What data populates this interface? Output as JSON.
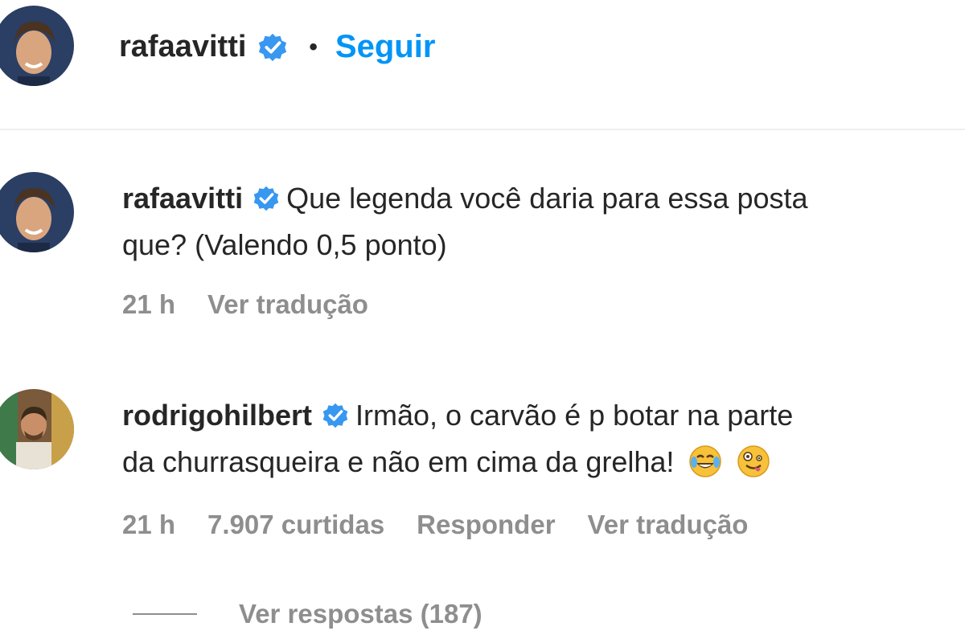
{
  "post_header": {
    "username": "rafaavitti",
    "separator": "•",
    "follow_label": "Seguir"
  },
  "comments": [
    {
      "username": "rafaavitti",
      "text_line1": "Que legenda você daria para essa posta",
      "text_line2": "que? (Valendo 0,5 ponto)",
      "time": "21 h",
      "translate_label": "Ver tradução"
    },
    {
      "username": "rodrigohilbert",
      "text_line1": "Irmão, o carvão é p botar na parte",
      "text_line2": "da churrasqueira e não em cima da grelha!",
      "emojis": [
        "tears-of-joy-emoji",
        "zany-face-emoji"
      ],
      "time": "21 h",
      "likes": "7.907 curtidas",
      "reply_label": "Responder",
      "translate_label": "Ver tradução",
      "view_replies_label": "Ver respostas (187)"
    }
  ],
  "colors": {
    "link_blue": "#0095f6",
    "text_primary": "#262626",
    "text_secondary": "#8e8e8e",
    "verified_blue": "#3897f0",
    "divider": "#efefef"
  },
  "icons": {
    "verified": "verified-badge-icon"
  }
}
